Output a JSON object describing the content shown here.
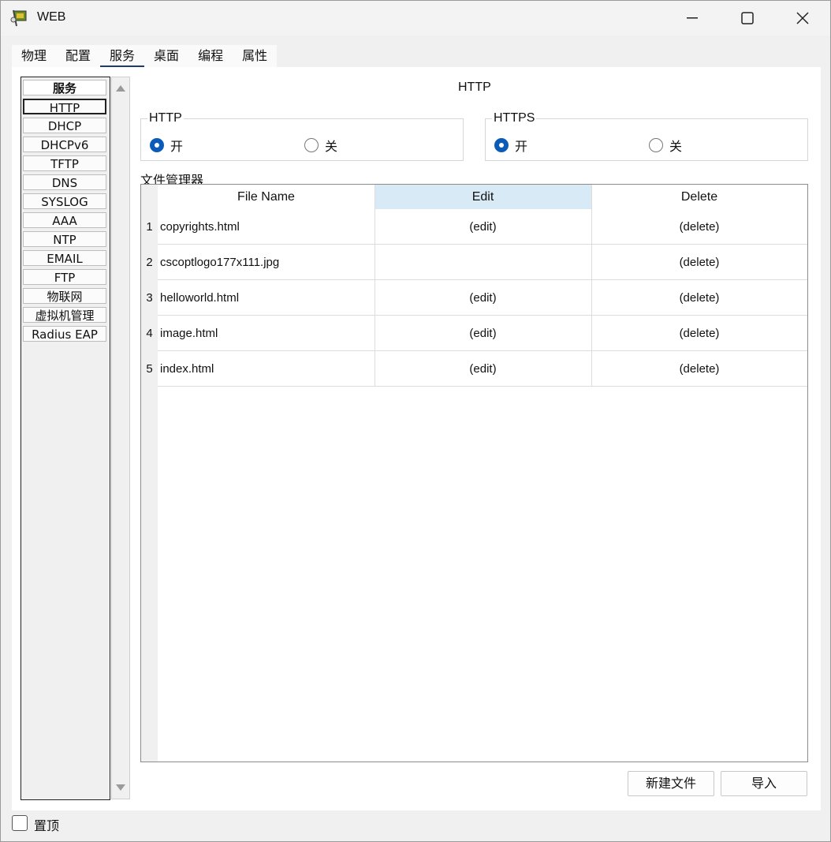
{
  "window": {
    "title": "WEB"
  },
  "tabs": [
    {
      "label": "物理"
    },
    {
      "label": "配置"
    },
    {
      "label": "服务",
      "active": true
    },
    {
      "label": "桌面"
    },
    {
      "label": "编程"
    },
    {
      "label": "属性"
    }
  ],
  "services": {
    "header": "服务",
    "items": [
      "HTTP",
      "DHCP",
      "DHCPv6",
      "TFTP",
      "DNS",
      "SYSLOG",
      "AAA",
      "NTP",
      "EMAIL",
      "FTP",
      "物联网",
      "虚拟机管理",
      "Radius EAP"
    ],
    "selected": "HTTP"
  },
  "main": {
    "section_title": "HTTP",
    "http_group": {
      "legend": "HTTP",
      "on_label": "开",
      "off_label": "关",
      "selected": "开"
    },
    "https_group": {
      "legend": "HTTPS",
      "on_label": "开",
      "off_label": "关",
      "selected": "开"
    },
    "file_manager_label": "文件管理器",
    "table": {
      "columns": [
        "File Name",
        "Edit",
        "Delete"
      ],
      "rows": [
        {
          "num": "1",
          "name": "copyrights.html",
          "edit": "(edit)",
          "delete": "(delete)"
        },
        {
          "num": "2",
          "name": "cscoptlogo177x111.jpg",
          "edit": "",
          "delete": "(delete)"
        },
        {
          "num": "3",
          "name": "helloworld.html",
          "edit": "(edit)",
          "delete": "(delete)"
        },
        {
          "num": "4",
          "name": "image.html",
          "edit": "(edit)",
          "delete": "(delete)"
        },
        {
          "num": "5",
          "name": "index.html",
          "edit": "(edit)",
          "delete": "(delete)"
        }
      ]
    },
    "new_file_button": "新建文件",
    "import_button": "导入"
  },
  "footer": {
    "always_on_top_label": "置顶",
    "always_on_top_checked": false
  },
  "colors": {
    "accent": "#0a5cb8",
    "tab_underline": "#1f3b6b",
    "edit_header_bg": "#d9eaf7"
  }
}
